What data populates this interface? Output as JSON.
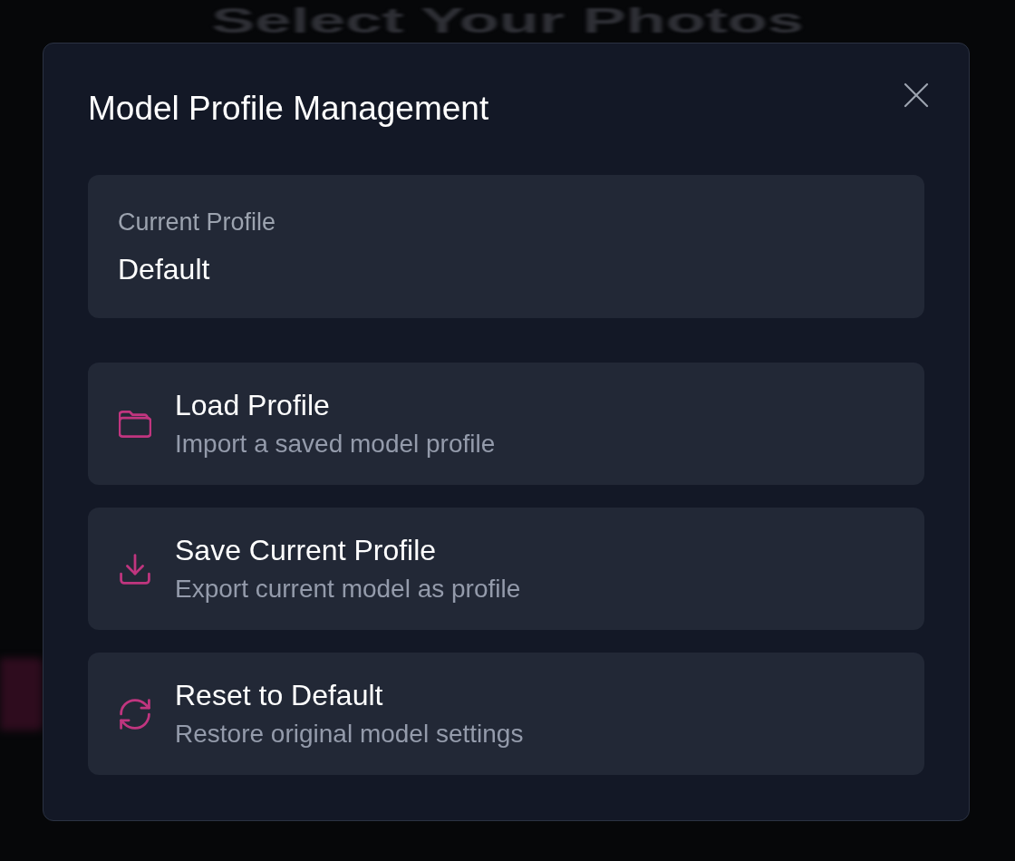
{
  "background": {
    "title": "Select Your Photos"
  },
  "dialog": {
    "title": "Model Profile Management",
    "current_profile": {
      "label": "Current Profile",
      "value": "Default"
    },
    "actions": [
      {
        "kind": "load",
        "title": "Load Profile",
        "description": "Import a saved model profile"
      },
      {
        "kind": "save",
        "title": "Save Current Profile",
        "description": "Export current model as profile"
      },
      {
        "kind": "reset",
        "title": "Reset to Default",
        "description": "Restore original model settings"
      }
    ]
  }
}
